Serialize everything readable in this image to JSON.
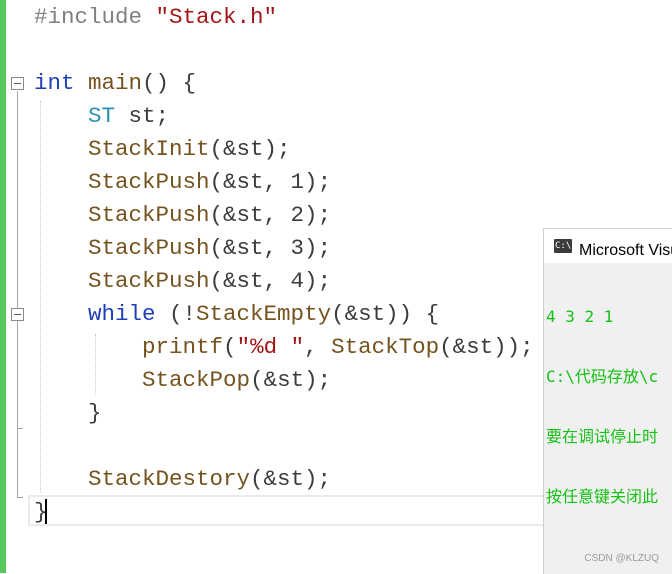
{
  "editor": {
    "lines": [
      {
        "tokens": [
          {
            "t": "#include ",
            "c": "pp"
          },
          {
            "t": "\"Stack.h\"",
            "c": "st"
          }
        ]
      },
      {
        "tokens": []
      },
      {
        "tokens": [
          {
            "t": "int",
            "c": "kw"
          },
          {
            "t": " ",
            "c": ""
          },
          {
            "t": "main",
            "c": "fn"
          },
          {
            "t": "() {",
            "c": ""
          }
        ]
      },
      {
        "tokens": [
          {
            "t": "    ",
            "c": ""
          },
          {
            "t": "ST",
            "c": "ty"
          },
          {
            "t": " st;",
            "c": ""
          }
        ]
      },
      {
        "tokens": [
          {
            "t": "    ",
            "c": ""
          },
          {
            "t": "StackInit",
            "c": "fn"
          },
          {
            "t": "(&st);",
            "c": ""
          }
        ]
      },
      {
        "tokens": [
          {
            "t": "    ",
            "c": ""
          },
          {
            "t": "StackPush",
            "c": "fn"
          },
          {
            "t": "(&st, 1);",
            "c": ""
          }
        ]
      },
      {
        "tokens": [
          {
            "t": "    ",
            "c": ""
          },
          {
            "t": "StackPush",
            "c": "fn"
          },
          {
            "t": "(&st, 2);",
            "c": ""
          }
        ]
      },
      {
        "tokens": [
          {
            "t": "    ",
            "c": ""
          },
          {
            "t": "StackPush",
            "c": "fn"
          },
          {
            "t": "(&st, 3);",
            "c": ""
          }
        ]
      },
      {
        "tokens": [
          {
            "t": "    ",
            "c": ""
          },
          {
            "t": "StackPush",
            "c": "fn"
          },
          {
            "t": "(&st, 4);",
            "c": ""
          }
        ]
      },
      {
        "tokens": [
          {
            "t": "    ",
            "c": ""
          },
          {
            "t": "while",
            "c": "kw"
          },
          {
            "t": " (!",
            "c": ""
          },
          {
            "t": "StackEmpty",
            "c": "fn"
          },
          {
            "t": "(&st)) {",
            "c": ""
          }
        ]
      },
      {
        "tokens": [
          {
            "t": "        ",
            "c": ""
          },
          {
            "t": "printf",
            "c": "fn"
          },
          {
            "t": "(",
            "c": ""
          },
          {
            "t": "\"%d \"",
            "c": "st"
          },
          {
            "t": ", ",
            "c": ""
          },
          {
            "t": "StackTop",
            "c": "fn"
          },
          {
            "t": "(&st));",
            "c": ""
          }
        ]
      },
      {
        "tokens": [
          {
            "t": "        ",
            "c": ""
          },
          {
            "t": "StackPop",
            "c": "fn"
          },
          {
            "t": "(&st);",
            "c": ""
          }
        ]
      },
      {
        "tokens": [
          {
            "t": "    }",
            "c": ""
          }
        ]
      },
      {
        "tokens": []
      },
      {
        "tokens": [
          {
            "t": "    ",
            "c": ""
          },
          {
            "t": "StackDestory",
            "c": "fn"
          },
          {
            "t": "(&st);",
            "c": ""
          }
        ]
      },
      {
        "tokens": [
          {
            "t": "}",
            "c": ""
          }
        ]
      }
    ]
  },
  "console": {
    "title": "Microsoft Visual Studio 调试控制台",
    "icon_label": "C:\\",
    "output": [
      "4 3 2 1",
      "C:\\代码存放\\c",
      "要在调试停止时",
      "按任意键关闭此"
    ]
  },
  "watermark": "CSDN @KLZUQ",
  "colors": {
    "keyword": "#1f3fb8",
    "type": "#2b91af",
    "function": "#74531f",
    "string": "#a31515",
    "preprocessor": "#808080",
    "console_text": "#13c214",
    "change_bar": "#57c95c"
  }
}
